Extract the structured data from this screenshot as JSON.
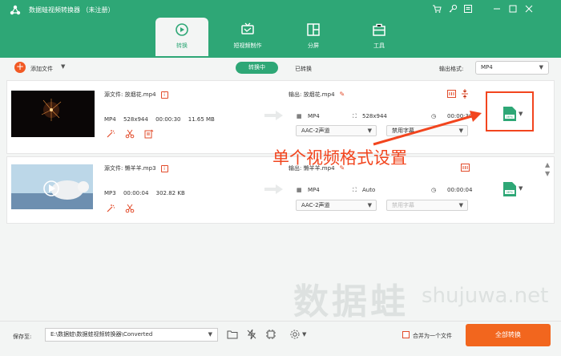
{
  "app": {
    "title": "数据蛙视频转换器 （未注册）",
    "accent": "#2ea776",
    "orange": "#f2661e"
  },
  "window_controls": [
    "cart-icon",
    "key-icon",
    "menu-icon",
    "minimize-icon",
    "maximize-icon",
    "close-icon"
  ],
  "tabs": [
    {
      "label": "转换",
      "icon": "convert-icon",
      "active": true
    },
    {
      "label": "短视频制作",
      "icon": "tv-icon",
      "active": false
    },
    {
      "label": "分屏",
      "icon": "split-screen-icon",
      "active": false
    },
    {
      "label": "工具",
      "icon": "toolbox-icon",
      "active": false
    }
  ],
  "toolbar": {
    "add_file": "添加文件",
    "converting": "转换中",
    "converted": "已转换",
    "output_format_label": "输出格式:",
    "output_format_value": "MP4"
  },
  "files": [
    {
      "source_label": "源文件: 放烟花.mp4",
      "format": "MP4",
      "resolution": "528x944",
      "duration": "00:00:30",
      "size": "11.65 MB",
      "output_label": "输出: 放烟花.mp4",
      "out_format": "MP4",
      "out_resolution": "528x944",
      "out_duration": "00:00:30",
      "audio": "AAC-2声道",
      "subtitle": "禁用字幕",
      "format_badge": "MP4"
    },
    {
      "source_label": "源文件: 懒羊羊.mp3",
      "format": "MP3",
      "resolution": "00:00:04",
      "duration": "",
      "size": "302.82 KB",
      "output_label": "输出: 懒羊羊.mp4",
      "out_format": "MP4",
      "out_resolution": "Auto",
      "out_duration": "00:00:04",
      "audio": "AAC-2声道",
      "subtitle": "禁用字幕",
      "format_badge": "MP4"
    }
  ],
  "annotation": {
    "text": "单个视频格式设置",
    "color": "#f2451e"
  },
  "watermark": {
    "text": "数据蛙",
    "url": "shujuwa.net"
  },
  "bottom": {
    "save_label": "保存至:",
    "save_path": "E:\\数据蛙\\数据蛙视频转换器\\Converted",
    "merge_label": "合并为一个文件",
    "convert_all": "全部转换"
  }
}
